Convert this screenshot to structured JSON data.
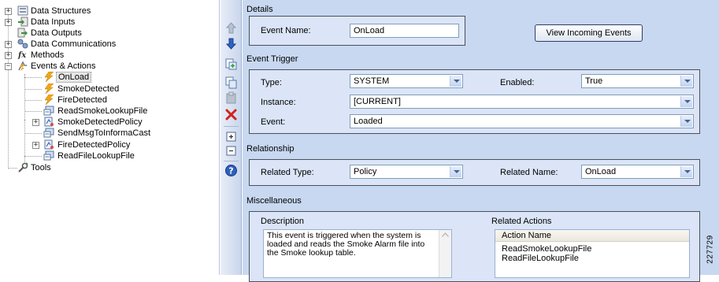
{
  "tree": {
    "items": [
      {
        "label": "Data Structures",
        "icon": "data-structures-icon",
        "toggle": "+"
      },
      {
        "label": "Data Inputs",
        "icon": "data-inputs-icon",
        "toggle": "+"
      },
      {
        "label": "Data Outputs",
        "icon": "data-outputs-icon",
        "toggle": ""
      },
      {
        "label": "Data Communications",
        "icon": "data-communications-icon",
        "toggle": "+"
      },
      {
        "label": "Methods",
        "icon": "function-icon",
        "toggle": "+"
      },
      {
        "label": "Events & Actions",
        "icon": "events-actions-icon",
        "toggle": "−"
      },
      {
        "label": "OnLoad",
        "icon": "event-lightning-icon",
        "selected": true
      },
      {
        "label": "SmokeDetected",
        "icon": "event-lightning-icon"
      },
      {
        "label": "FireDetected",
        "icon": "event-lightning-icon"
      },
      {
        "label": "ReadSmokeLookupFile",
        "icon": "action-icon"
      },
      {
        "label": "SmokeDetectedPolicy",
        "icon": "policy-icon",
        "toggle": "+"
      },
      {
        "label": "SendMsgToInformaCast",
        "icon": "action-icon"
      },
      {
        "label": "FireDetectedPolicy",
        "icon": "policy-icon",
        "toggle": "+"
      },
      {
        "label": "ReadFileLookupFile",
        "icon": "action-icon"
      },
      {
        "label": "Tools",
        "icon": "tools-icon"
      }
    ]
  },
  "toolbar": {
    "buttons": [
      {
        "name": "move-up-icon"
      },
      {
        "name": "move-down-icon"
      },
      {
        "name": "add-item-icon"
      },
      {
        "name": "copy-icon"
      },
      {
        "name": "paste-icon"
      },
      {
        "name": "delete-icon"
      },
      {
        "name": "expand-icon"
      },
      {
        "name": "collapse-icon"
      },
      {
        "name": "help-icon"
      }
    ]
  },
  "details": {
    "section_label": "Details",
    "event_name_label": "Event Name:",
    "event_name_value": "OnLoad",
    "view_incoming_button": "View Incoming Events"
  },
  "trigger": {
    "section_label": "Event Trigger",
    "type_label": "Type:",
    "type_value": "SYSTEM",
    "enabled_label": "Enabled:",
    "enabled_value": "True",
    "instance_label": "Instance:",
    "instance_value": "[CURRENT]",
    "event_label": "Event:",
    "event_value": "Loaded"
  },
  "relationship": {
    "section_label": "Relationship",
    "related_type_label": "Related Type:",
    "related_type_value": "Policy",
    "related_name_label": "Related Name:",
    "related_name_value": "OnLoad"
  },
  "misc": {
    "section_label": "Miscellaneous",
    "description_label": "Description",
    "description_text": "This event is triggered when the system is loaded and reads the Smoke Alarm file into the Smoke lookup table.",
    "related_actions_label": "Related Actions",
    "action_name_header": "Action Name",
    "actions": [
      "ReadSmokeLookupFile",
      "ReadFileLookupFile"
    ]
  },
  "figure_number": "227729",
  "colors": {
    "pane_bg": "#c8d8f1",
    "panel_bg": "#dbe5f7",
    "panel_border": "#4a4f5c"
  }
}
